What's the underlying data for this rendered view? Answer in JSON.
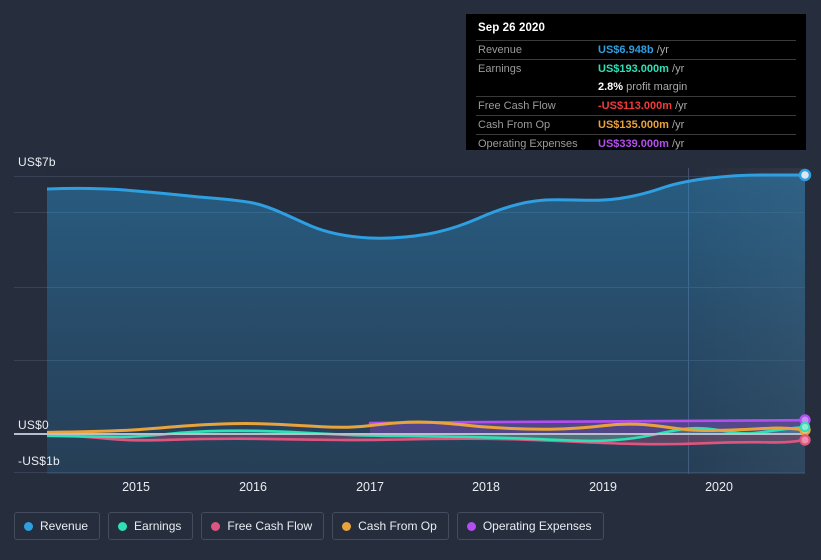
{
  "tooltip": {
    "date": "Sep 26 2020",
    "rows": [
      {
        "label": "Revenue",
        "value": "US$6.948b",
        "unit": "/yr",
        "color": "#2e9fe0"
      },
      {
        "label": "Earnings",
        "value": "US$193.000m",
        "unit": "/yr",
        "color": "#2ee0b5"
      },
      {
        "label": "",
        "value": "2.8%",
        "unit": "profit margin",
        "color": "#ffffff"
      },
      {
        "label": "Free Cash Flow",
        "value": "-US$113.000m",
        "unit": "/yr",
        "color": "#ef3b3b"
      },
      {
        "label": "Cash From Op",
        "value": "US$135.000m",
        "unit": "/yr",
        "color": "#e8a33d"
      },
      {
        "label": "Operating Expenses",
        "value": "US$339.000m",
        "unit": "/yr",
        "color": "#b44ef0"
      }
    ]
  },
  "legend": [
    {
      "label": "Revenue",
      "color": "#2e9fe0"
    },
    {
      "label": "Earnings",
      "color": "#2ee0b5"
    },
    {
      "label": "Free Cash Flow",
      "color": "#e0557f"
    },
    {
      "label": "Cash From Op",
      "color": "#e8a33d"
    },
    {
      "label": "Operating Expenses",
      "color": "#b44ef0"
    }
  ],
  "chart_data": {
    "type": "area",
    "title": "",
    "xlabel": "",
    "ylabel": "",
    "grid": true,
    "legend_position": "bottom",
    "yticks": [
      "US$7b",
      "US$0",
      "-US$1b"
    ],
    "ytick_values": [
      7,
      0,
      -1
    ],
    "ylim": [
      -1,
      7.55
    ],
    "xticks": [
      "2015",
      "2016",
      "2017",
      "2018",
      "2019",
      "2020"
    ],
    "xlim": [
      "2014-06",
      "2020-12"
    ],
    "units": "US$ billions per year",
    "forecast_divider_x": "2019-07",
    "last_point_label": "Sep 26 2020",
    "x": [
      "2014-06",
      "2014-09",
      "2014-12",
      "2015-03",
      "2015-06",
      "2015-09",
      "2015-12",
      "2016-03",
      "2016-06",
      "2016-09",
      "2016-12",
      "2017-03",
      "2017-06",
      "2017-09",
      "2017-12",
      "2018-03",
      "2018-06",
      "2018-09",
      "2018-12",
      "2019-03",
      "2019-06",
      "2019-09",
      "2019-12",
      "2020-03",
      "2020-06",
      "2020-09"
    ],
    "series": [
      {
        "name": "Revenue",
        "color": "#2e9fe0",
        "filled": true,
        "values": [
          6.7,
          6.7,
          6.68,
          6.62,
          6.52,
          6.44,
          6.4,
          6.22,
          5.98,
          5.72,
          5.52,
          5.38,
          5.32,
          5.28,
          5.3,
          5.38,
          5.52,
          5.72,
          5.98,
          6.2,
          6.38,
          6.44,
          6.42,
          6.52,
          6.78,
          6.948
        ]
      },
      {
        "name": "Earnings",
        "color": "#2ee0b5",
        "filled": true,
        "values": [
          -0.05,
          -0.06,
          -0.07,
          -0.08,
          -0.08,
          -0.02,
          0.03,
          0.04,
          0.02,
          0.01,
          0.0,
          -0.02,
          -0.04,
          -0.05,
          -0.05,
          -0.05,
          -0.06,
          -0.08,
          -0.1,
          -0.12,
          -0.1,
          0.02,
          0.1,
          0.02,
          0.12,
          0.193
        ]
      },
      {
        "name": "Free Cash Flow",
        "color": "#e0557f",
        "filled": true,
        "values": [
          -0.02,
          -0.03,
          -0.08,
          -0.14,
          -0.16,
          -0.14,
          -0.12,
          -0.12,
          -0.12,
          -0.13,
          -0.14,
          -0.15,
          -0.16,
          -0.16,
          -0.15,
          -0.14,
          -0.13,
          -0.14,
          -0.18,
          -0.22,
          -0.24,
          -0.22,
          -0.2,
          -0.24,
          -0.2,
          -0.113
        ]
      },
      {
        "name": "Cash From Op",
        "color": "#e8a33d",
        "filled": false,
        "values": [
          0.04,
          0.05,
          0.05,
          0.06,
          0.09,
          0.14,
          0.18,
          0.19,
          0.18,
          0.16,
          0.14,
          0.12,
          0.12,
          0.16,
          0.2,
          0.18,
          0.14,
          0.12,
          0.12,
          0.14,
          0.18,
          0.14,
          0.1,
          0.12,
          0.16,
          0.135
        ]
      },
      {
        "name": "Operating Expenses",
        "color": "#b44ef0",
        "filled": true,
        "values": [
          null,
          null,
          null,
          null,
          null,
          null,
          null,
          null,
          null,
          null,
          null,
          null,
          0.28,
          0.29,
          0.3,
          0.3,
          0.3,
          0.3,
          0.31,
          0.31,
          0.32,
          0.32,
          0.33,
          0.33,
          0.34,
          0.339
        ]
      }
    ]
  }
}
